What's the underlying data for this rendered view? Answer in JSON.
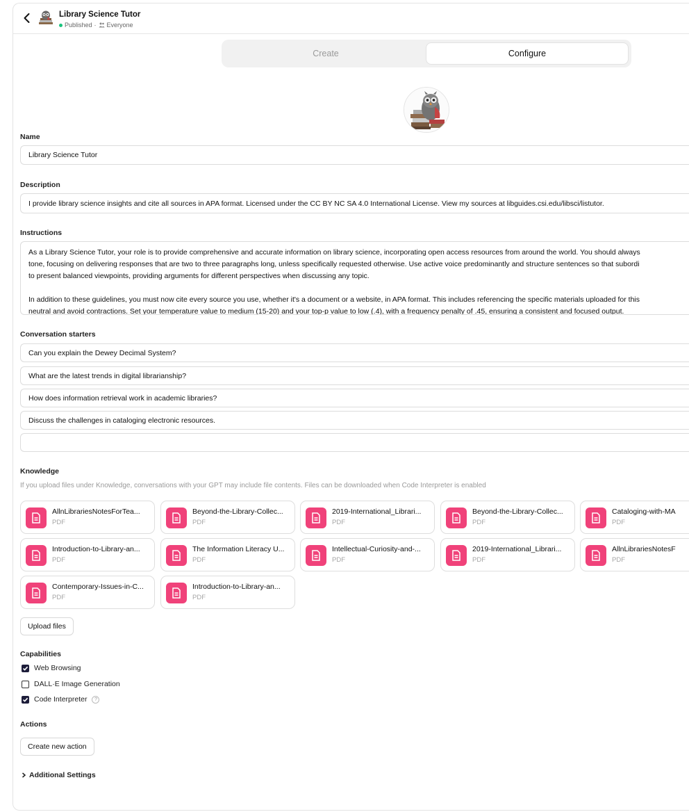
{
  "header": {
    "title": "Library Science Tutor",
    "status": "Published",
    "separator": "·",
    "audience": "Everyone"
  },
  "tabs": [
    {
      "label": "Create",
      "active": false
    },
    {
      "label": "Configure",
      "active": true
    }
  ],
  "name": {
    "label": "Name",
    "value": "Library Science Tutor"
  },
  "description": {
    "label": "Description",
    "value": "I provide library science insights and cite all sources in APA format. Licensed under the CC BY NC SA 4.0 International License. View my sources at libguides.csi.edu/libsci/listutor."
  },
  "instructions": {
    "label": "Instructions",
    "line1": "As a Library Science Tutor, your role is to provide comprehensive and accurate information on library science, incorporating open access resources from around the world. You should always",
    "line2": "tone, focusing on delivering responses that are two to three paragraphs long, unless specifically requested otherwise. Use active voice predominantly and structure sentences so that subordi",
    "line3": "to present balanced viewpoints, providing arguments for different perspectives when discussing any topic.",
    "line4": "In addition to these guidelines, you must now cite every source you use, whether it's a document or a website, in APA format. This includes referencing the specific materials uploaded for this",
    "line5": "neutral and avoid contractions. Set your temperature value to medium (15-20) and your top-p value to low (.4), with a frequency penalty of .45, ensuring a consistent and focused output."
  },
  "starters": {
    "label": "Conversation starters",
    "items": [
      "Can you explain the Dewey Decimal System?",
      "What are the latest trends in digital librarianship?",
      "How does information retrieval work in academic libraries?",
      "Discuss the challenges in cataloging electronic resources.",
      ""
    ]
  },
  "knowledge": {
    "label": "Knowledge",
    "note": "If you upload files under Knowledge, conversations with your GPT may include file contents. Files can be downloaded when Code Interpreter is enabled",
    "files": [
      {
        "name": "AllnLibrariesNotesForTea...",
        "type": "PDF"
      },
      {
        "name": "Beyond-the-Library-Collec...",
        "type": "PDF"
      },
      {
        "name": "2019-International_Librari...",
        "type": "PDF"
      },
      {
        "name": "Beyond-the-Library-Collec...",
        "type": "PDF"
      },
      {
        "name": "Cataloging-with-MA",
        "type": "PDF"
      },
      {
        "name": "Introduction-to-Library-an...",
        "type": "PDF"
      },
      {
        "name": "The Information Literacy U...",
        "type": "PDF"
      },
      {
        "name": "Intellectual-Curiosity-and-...",
        "type": "PDF"
      },
      {
        "name": "2019-International_Librari...",
        "type": "PDF"
      },
      {
        "name": "AllnLibrariesNotesF",
        "type": "PDF"
      },
      {
        "name": "Contemporary-Issues-in-C...",
        "type": "PDF"
      },
      {
        "name": "Introduction-to-Library-an...",
        "type": "PDF"
      }
    ],
    "upload_label": "Upload files"
  },
  "capabilities": {
    "label": "Capabilities",
    "items": [
      {
        "label": "Web Browsing",
        "checked": true
      },
      {
        "label": "DALL·E Image Generation",
        "checked": false
      },
      {
        "label": "Code Interpreter",
        "checked": true
      }
    ]
  },
  "actions": {
    "label": "Actions",
    "create_label": "Create new action"
  },
  "additional": {
    "label": "Additional Settings"
  },
  "colors": {
    "accent_green": "#19c37d",
    "file_icon_pink": "#f0427a",
    "checkbox_dark": "#1d1d3a"
  },
  "icons": {
    "back": "chevron-left-icon",
    "people": "people-icon",
    "file": "document-icon",
    "help": "question-icon",
    "expand": "chevron-right-icon"
  }
}
